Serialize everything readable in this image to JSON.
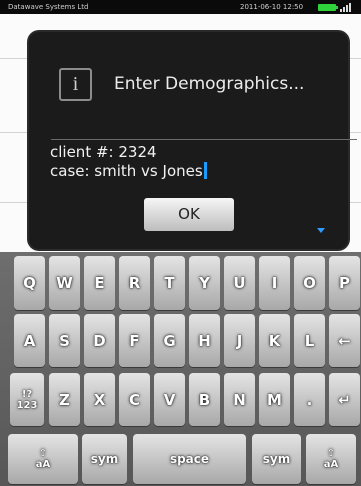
{
  "status_bar": {
    "carrier": "Datawave Systems Ltd",
    "datetime": "2011-06-10  12:50"
  },
  "dialog": {
    "title": "Enter Demographics...",
    "info_symbol": "i",
    "client_line": "client #: 2324",
    "case_line": "case: smith vs Jones",
    "ok_label": "OK"
  },
  "keyboard": {
    "row1": [
      "Q",
      "W",
      "E",
      "R",
      "T",
      "Y",
      "U",
      "I",
      "O",
      "P"
    ],
    "row2": [
      "A",
      "S",
      "D",
      "F",
      "G",
      "H",
      "J",
      "K",
      "L",
      "←"
    ],
    "row3": [
      "!?\n123",
      "Z",
      "X",
      "C",
      "V",
      "B",
      "N",
      "M",
      ".",
      "↵"
    ],
    "row4": [
      "⇧\naA",
      "sym",
      "space",
      "sym",
      "⇧\naA"
    ]
  }
}
